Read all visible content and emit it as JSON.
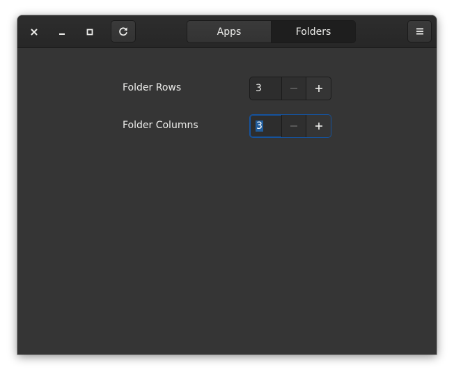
{
  "headerbar": {
    "window_controls": [
      "close",
      "minimize",
      "maximize"
    ],
    "refresh_icon": "refresh-icon",
    "menu_icon": "hamburger-menu-icon"
  },
  "view_switcher": {
    "tabs": [
      {
        "label": "Apps",
        "active": false
      },
      {
        "label": "Folders",
        "active": true
      }
    ]
  },
  "settings": {
    "rows": [
      {
        "label": "Folder Rows",
        "value": "3",
        "minus_enabled": false,
        "focused": false
      },
      {
        "label": "Folder Columns",
        "value": "3",
        "minus_enabled": false,
        "focused": true
      }
    ]
  },
  "colors": {
    "window_bg": "#353535",
    "headerbar_bg": "#2d2d2d",
    "accent": "#15539e",
    "text": "#eeeeec",
    "disabled_text": "#6b6b6b"
  }
}
